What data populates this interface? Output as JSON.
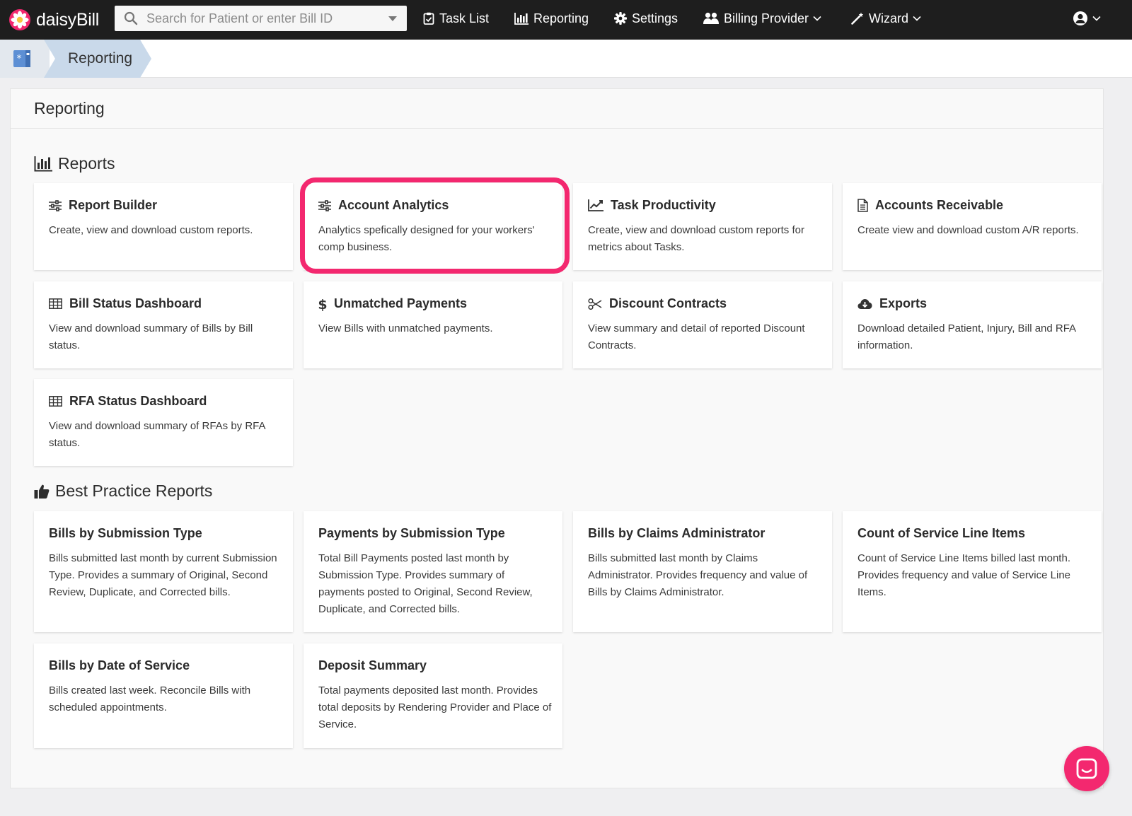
{
  "app": {
    "brand": "daisyBill"
  },
  "colors": {
    "nav_bg": "#1e1e1e",
    "accent": "#f3286f",
    "breadcrumb_active": "#c9d9ea"
  },
  "search": {
    "placeholder": "Search for Patient or enter Bill ID",
    "value": ""
  },
  "nav": {
    "task_list": "Task List",
    "reporting": "Reporting",
    "settings": "Settings",
    "billing_provider": "Billing Provider",
    "wizard": "Wizard"
  },
  "breadcrumb": {
    "current": "Reporting"
  },
  "page": {
    "title": "Reporting"
  },
  "sections": {
    "reports": {
      "title": "Reports",
      "cards": [
        {
          "icon": "sliders-icon",
          "title": "Report Builder",
          "desc": "Create, view and download custom reports."
        },
        {
          "icon": "sliders-icon",
          "title": "Account Analytics",
          "desc": "Analytics spefically designed for your workers' comp business."
        },
        {
          "icon": "line-chart-icon",
          "title": "Task Productivity",
          "desc": "Create, view and download custom reports for metrics about Tasks."
        },
        {
          "icon": "document-icon",
          "title": "Accounts Receivable",
          "desc": "Create view and download custom A/R reports."
        },
        {
          "icon": "table-icon",
          "title": "Bill Status Dashboard",
          "desc": "View and download summary of Bills by Bill status."
        },
        {
          "icon": "dollar-icon",
          "title": "Unmatched Payments",
          "desc": "View Bills with unmatched payments."
        },
        {
          "icon": "scissors-icon",
          "title": "Discount Contracts",
          "desc": "View summary and detail of reported Discount Contracts."
        },
        {
          "icon": "cloud-download-icon",
          "title": "Exports",
          "desc": "Download detailed Patient, Injury, Bill and RFA information."
        },
        {
          "icon": "table-icon",
          "title": "RFA Status Dashboard",
          "desc": "View and download summary of RFAs by RFA status."
        }
      ]
    },
    "best_practice": {
      "title": "Best Practice Reports",
      "cards": [
        {
          "title": "Bills by Submission Type",
          "desc": "Bills submitted last month by current Submission Type. Provides a summary of Original, Second Review, Duplicate, and Corrected bills."
        },
        {
          "title": "Payments by Submission Type",
          "desc": "Total Bill Payments posted last month by Submission Type. Provides summary of payments posted to Original, Second Review, Duplicate, and Corrected bills."
        },
        {
          "title": "Bills by Claims Administrator",
          "desc": "Bills submitted last month by Claims Administrator. Provides frequency and value of Bills by Claims Administrator."
        },
        {
          "title": "Count of Service Line Items",
          "desc": "Count of Service Line Items billed last month. Provides frequency and value of Service Line Items."
        },
        {
          "title": "Bills by Date of Service",
          "desc": "Bills created last week. Reconcile Bills with scheduled appointments."
        },
        {
          "title": "Deposit Summary",
          "desc": "Total payments deposited last month. Provides total deposits by Rendering Provider and Place of Service."
        }
      ]
    }
  }
}
